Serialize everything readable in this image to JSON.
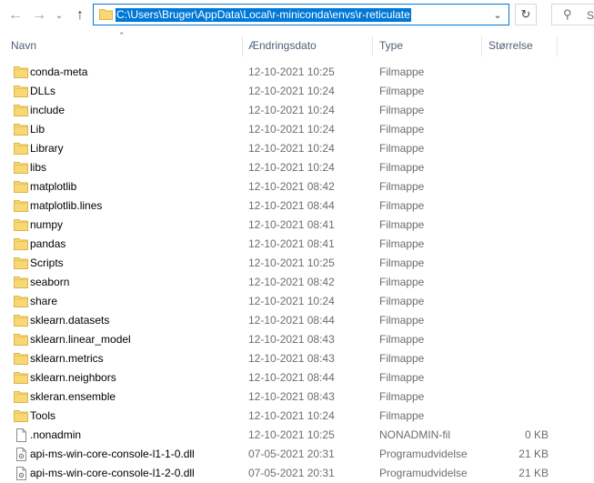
{
  "toolbar": {
    "back_icon": "arrow-left-icon",
    "forward_icon": "arrow-right-icon",
    "recent_icon": "chevron-down-icon",
    "up_icon": "arrow-up-icon",
    "address": "C:\\Users\\Bruger\\AppData\\Local\\r-miniconda\\envs\\r-reticulate",
    "refresh_icon": "refresh-icon",
    "search_placeholder": "S"
  },
  "columns": {
    "name": "Navn",
    "date": "Ændringsdato",
    "type": "Type",
    "size": "Størrelse"
  },
  "colors": {
    "accent": "#0078d7",
    "folder": "#f8d775",
    "header_text": "#4c607a"
  },
  "files": [
    {
      "name": "conda-meta",
      "date": "12-10-2021 10:25",
      "type": "Filmappe",
      "size": "",
      "icon": "folder-icon"
    },
    {
      "name": "DLLs",
      "date": "12-10-2021 10:24",
      "type": "Filmappe",
      "size": "",
      "icon": "folder-icon"
    },
    {
      "name": "include",
      "date": "12-10-2021 10:24",
      "type": "Filmappe",
      "size": "",
      "icon": "folder-icon"
    },
    {
      "name": "Lib",
      "date": "12-10-2021 10:24",
      "type": "Filmappe",
      "size": "",
      "icon": "folder-icon"
    },
    {
      "name": "Library",
      "date": "12-10-2021 10:24",
      "type": "Filmappe",
      "size": "",
      "icon": "folder-icon"
    },
    {
      "name": "libs",
      "date": "12-10-2021 10:24",
      "type": "Filmappe",
      "size": "",
      "icon": "folder-icon"
    },
    {
      "name": "matplotlib",
      "date": "12-10-2021 08:42",
      "type": "Filmappe",
      "size": "",
      "icon": "folder-icon"
    },
    {
      "name": "matplotlib.lines",
      "date": "12-10-2021 08:44",
      "type": "Filmappe",
      "size": "",
      "icon": "folder-icon"
    },
    {
      "name": "numpy",
      "date": "12-10-2021 08:41",
      "type": "Filmappe",
      "size": "",
      "icon": "folder-icon"
    },
    {
      "name": "pandas",
      "date": "12-10-2021 08:41",
      "type": "Filmappe",
      "size": "",
      "icon": "folder-icon"
    },
    {
      "name": "Scripts",
      "date": "12-10-2021 10:25",
      "type": "Filmappe",
      "size": "",
      "icon": "folder-icon"
    },
    {
      "name": "seaborn",
      "date": "12-10-2021 08:42",
      "type": "Filmappe",
      "size": "",
      "icon": "folder-icon"
    },
    {
      "name": "share",
      "date": "12-10-2021 10:24",
      "type": "Filmappe",
      "size": "",
      "icon": "folder-icon"
    },
    {
      "name": "sklearn.datasets",
      "date": "12-10-2021 08:44",
      "type": "Filmappe",
      "size": "",
      "icon": "folder-icon"
    },
    {
      "name": "sklearn.linear_model",
      "date": "12-10-2021 08:43",
      "type": "Filmappe",
      "size": "",
      "icon": "folder-icon"
    },
    {
      "name": "sklearn.metrics",
      "date": "12-10-2021 08:43",
      "type": "Filmappe",
      "size": "",
      "icon": "folder-icon"
    },
    {
      "name": "sklearn.neighbors",
      "date": "12-10-2021 08:44",
      "type": "Filmappe",
      "size": "",
      "icon": "folder-icon"
    },
    {
      "name": "skleran.ensemble",
      "date": "12-10-2021 08:43",
      "type": "Filmappe",
      "size": "",
      "icon": "folder-icon"
    },
    {
      "name": "Tools",
      "date": "12-10-2021 10:24",
      "type": "Filmappe",
      "size": "",
      "icon": "folder-icon"
    },
    {
      "name": ".nonadmin",
      "date": "12-10-2021 10:25",
      "type": "NONADMIN-fil",
      "size": "0 KB",
      "icon": "file-icon"
    },
    {
      "name": "api-ms-win-core-console-l1-1-0.dll",
      "date": "07-05-2021 20:31",
      "type": "Programudvidelse",
      "size": "21 KB",
      "icon": "dll-file-icon"
    },
    {
      "name": "api-ms-win-core-console-l1-2-0.dll",
      "date": "07-05-2021 20:31",
      "type": "Programudvidelse",
      "size": "21 KB",
      "icon": "dll-file-icon"
    }
  ]
}
